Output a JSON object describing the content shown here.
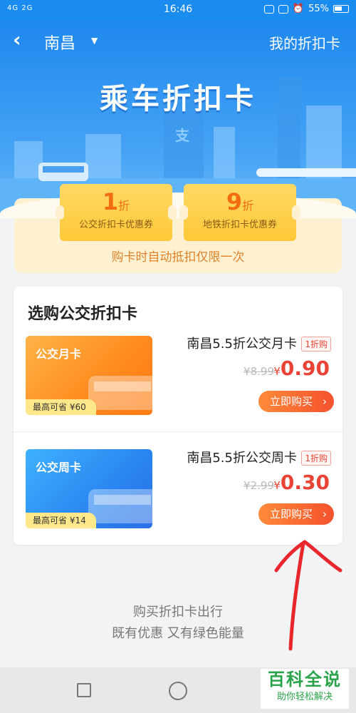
{
  "status_bar": {
    "left": "4G 2G",
    "time": "16:46",
    "battery": "55%"
  },
  "header": {
    "back_icon": "‹",
    "city": "南昌",
    "city_arrow": "▼",
    "my_cards": "我的折扣卡",
    "banner_title": "乘车折扣卡"
  },
  "coupons": [
    {
      "discount": "1",
      "unit": "折",
      "label": "公交折扣卡优惠券"
    },
    {
      "discount": "9",
      "unit": "折",
      "label": "地铁折扣卡优惠券"
    }
  ],
  "coupon_note": "购卡时自动抵扣仅限一次",
  "buy_section": {
    "title": "选购公交折扣卡",
    "products": [
      {
        "card_name": "公交月卡",
        "save": "最高可省 ¥60",
        "name": "南昌5.5折公交月卡",
        "tag": "1折购",
        "orig_price": "¥8.99",
        "currency": "¥",
        "price": "0.90",
        "button": "立即购买"
      },
      {
        "card_name": "公交周卡",
        "save": "最高可省 ¥14",
        "name": "南昌5.5折公交周卡",
        "tag": "1折购",
        "orig_price": "¥2.99",
        "currency": "¥",
        "price": "0.30",
        "button": "立即购买"
      }
    ]
  },
  "slogan": {
    "line1": "购买折扣卡出行",
    "line2": "既有优惠 又有绿色能量"
  },
  "watermark": {
    "title": "百科全说",
    "subtitle": "助你轻松解决"
  },
  "colors": {
    "primary_blue": "#1e88ee",
    "price_red": "#e94335",
    "coupon_yellow": "#ffc837",
    "annotation_red": "#e8262b"
  }
}
